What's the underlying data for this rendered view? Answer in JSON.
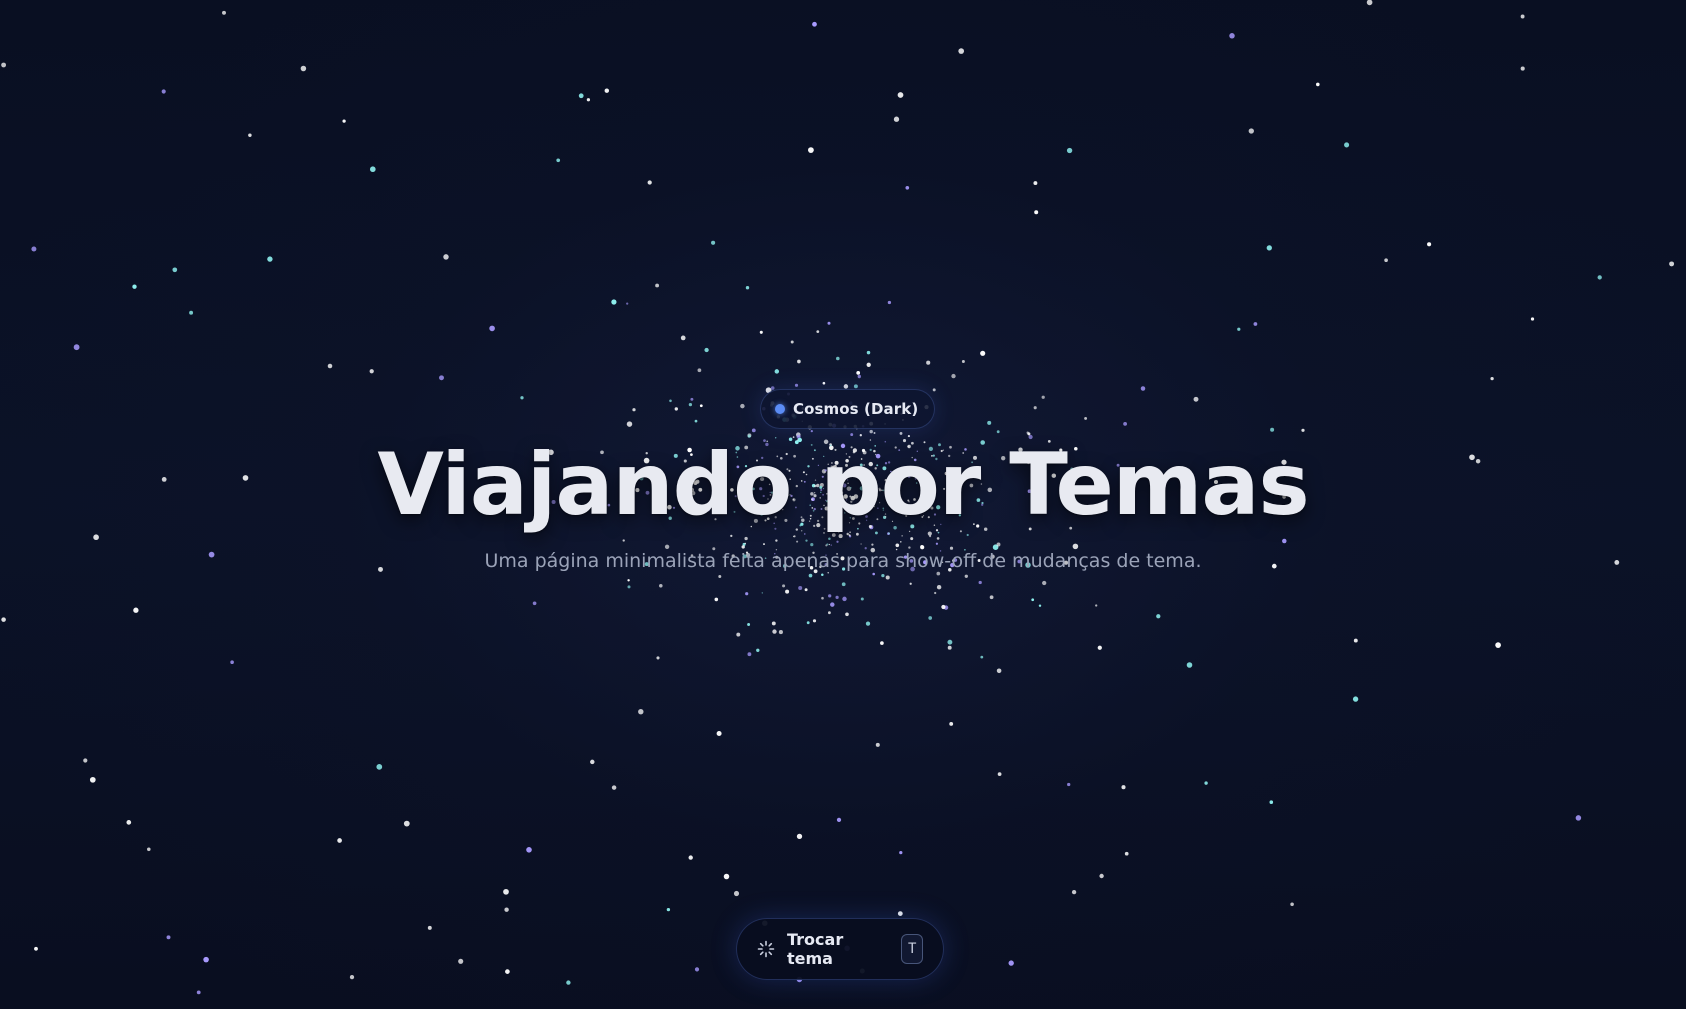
{
  "theme_badge": {
    "label": "Cosmos (Dark)",
    "dot_color": "#5b8cf4"
  },
  "hero": {
    "title": "Viajando por Temas",
    "subtitle": "Uma página minimalista feita apenas para show-off de mudanças de tema."
  },
  "theme_toggle": {
    "icon": "sparkle-icon",
    "label": "Trocar tema",
    "shortcut_key": "T"
  },
  "colors": {
    "background": "#0b1124",
    "star_white": "#ffffff",
    "star_cyan": "#8ef0ee",
    "star_violet": "#a99bff",
    "accent_blue": "#5b8cf4",
    "text_primary": "#e8eaf1",
    "text_secondary": "#9ba3b8"
  }
}
